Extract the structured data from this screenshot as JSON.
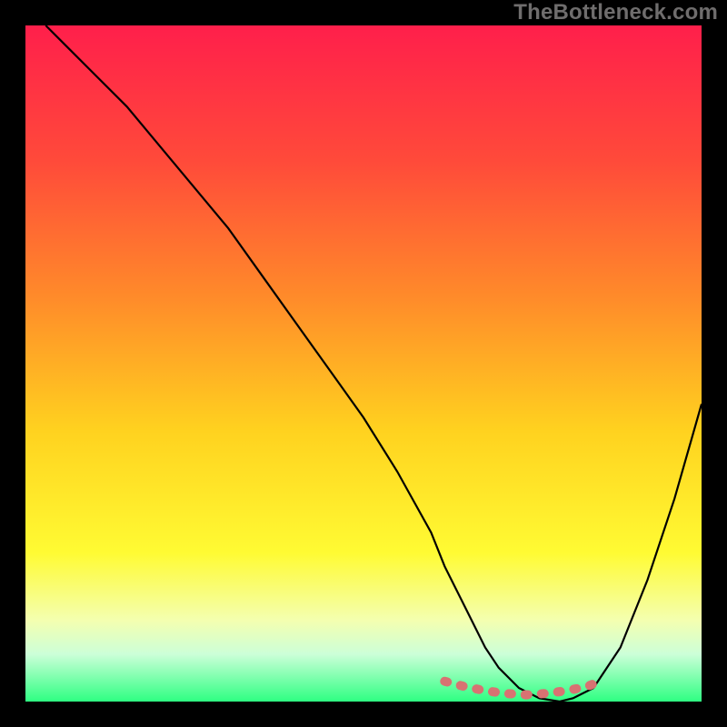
{
  "watermark": "TheBottleneck.com",
  "chart_data": {
    "type": "line",
    "title": "",
    "xlabel": "",
    "ylabel": "",
    "xlim": [
      0,
      100
    ],
    "ylim": [
      0,
      100
    ],
    "series": [
      {
        "name": "bottleneck-curve",
        "x": [
          3,
          6,
          10,
          15,
          20,
          25,
          30,
          35,
          40,
          45,
          50,
          55,
          60,
          62,
          65,
          68,
          70,
          73,
          76,
          79,
          81,
          84,
          88,
          92,
          96,
          100
        ],
        "y": [
          100,
          97,
          93,
          88,
          82,
          76,
          70,
          63,
          56,
          49,
          42,
          34,
          25,
          20,
          14,
          8,
          5,
          2,
          0.5,
          0,
          0.5,
          2,
          8,
          18,
          30,
          44
        ]
      },
      {
        "name": "optimal-flat-marker",
        "x": [
          62,
          65,
          68,
          71,
          74,
          77,
          80,
          83,
          85
        ],
        "y": [
          3,
          2.2,
          1.6,
          1.2,
          1,
          1.2,
          1.6,
          2.2,
          3
        ]
      }
    ],
    "gradient_stops": [
      {
        "offset": 0,
        "color": "#ff1f4b"
      },
      {
        "offset": 20,
        "color": "#ff4a3a"
      },
      {
        "offset": 40,
        "color": "#ff8a2a"
      },
      {
        "offset": 60,
        "color": "#ffd21f"
      },
      {
        "offset": 78,
        "color": "#fffb33"
      },
      {
        "offset": 88,
        "color": "#f4ffb0"
      },
      {
        "offset": 93,
        "color": "#ccffd8"
      },
      {
        "offset": 100,
        "color": "#2eff82"
      }
    ],
    "marker_color": "#d87272",
    "curve_color": "#000000"
  }
}
